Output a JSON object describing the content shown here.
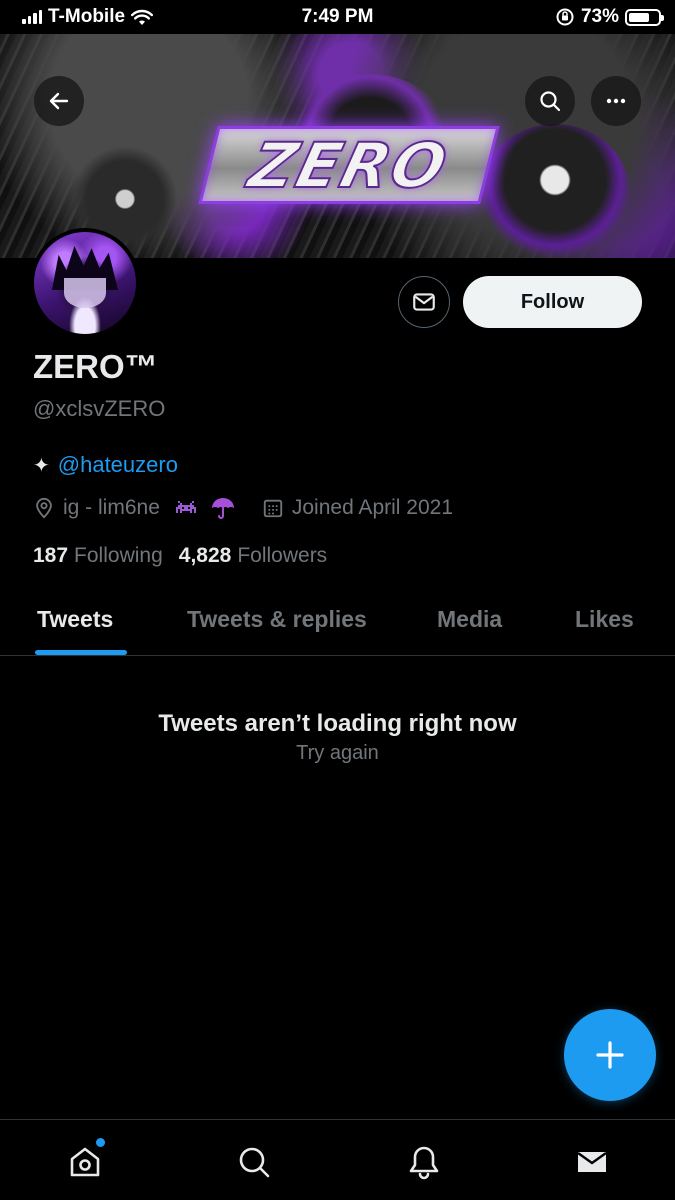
{
  "status_bar": {
    "carrier": "T-Mobile",
    "time": "7:49 PM",
    "battery_percent": "73%",
    "battery_level": 0.73,
    "icons": [
      "signal-icon",
      "wifi-icon",
      "orientation-lock-icon",
      "battery-icon"
    ]
  },
  "banner": {
    "logo_text": "ZERO",
    "accent_color": "#8e3ee0"
  },
  "profile": {
    "display_name": "ZERO™",
    "handle": "@xclsvZERO",
    "bio_symbol": "✦",
    "bio_link": "@hateuzero",
    "location": "ig - lim6ne",
    "joined": "Joined April 2021"
  },
  "actions": {
    "follow_label": "Follow"
  },
  "stats": {
    "following_count": "187",
    "following_label": "Following",
    "followers_count": "4,828",
    "followers_label": "Followers"
  },
  "tabs": [
    {
      "label": "Tweets",
      "active": true
    },
    {
      "label": "Tweets & replies",
      "active": false
    },
    {
      "label": "Media",
      "active": false
    },
    {
      "label": "Likes",
      "active": false
    }
  ],
  "empty_state": {
    "title": "Tweets aren’t loading right now",
    "action": "Try again"
  },
  "bottom_nav": [
    "home-icon",
    "search-icon",
    "notifications-icon",
    "messages-icon"
  ],
  "colors": {
    "accent": "#1d9bf0",
    "background": "#000000",
    "secondary_text": "#71767b"
  }
}
